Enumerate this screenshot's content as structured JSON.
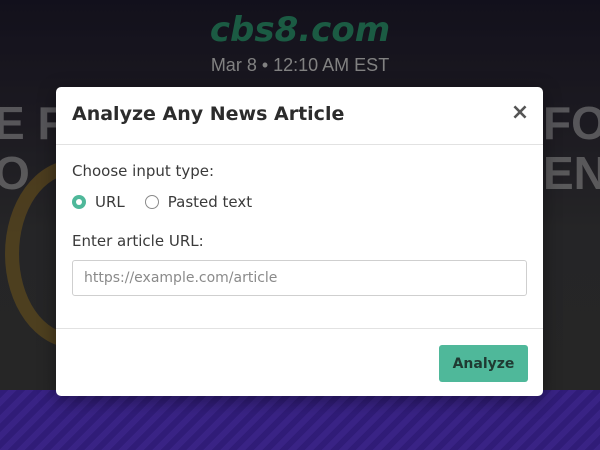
{
  "background": {
    "site_logo": "cbs8.com",
    "date_line": "Mar 8 • 12:10 AM EST",
    "overlay_letters_left": "E F\nO",
    "overlay_letters_right": "FO\nEN"
  },
  "modal": {
    "title": "Analyze Any News Article",
    "close_glyph": "×",
    "input_type_label": "Choose input type:",
    "radio_options": [
      {
        "label": "URL",
        "checked": true
      },
      {
        "label": "Pasted text",
        "checked": false
      }
    ],
    "url_label": "Enter article URL:",
    "url_input": {
      "value": "",
      "placeholder": "https://example.com/article"
    },
    "submit_label": "Analyze"
  },
  "colors": {
    "accent": "#4fb89a",
    "logo_green": "#2a8c67",
    "bottom_banner": "#4a2bb8"
  }
}
